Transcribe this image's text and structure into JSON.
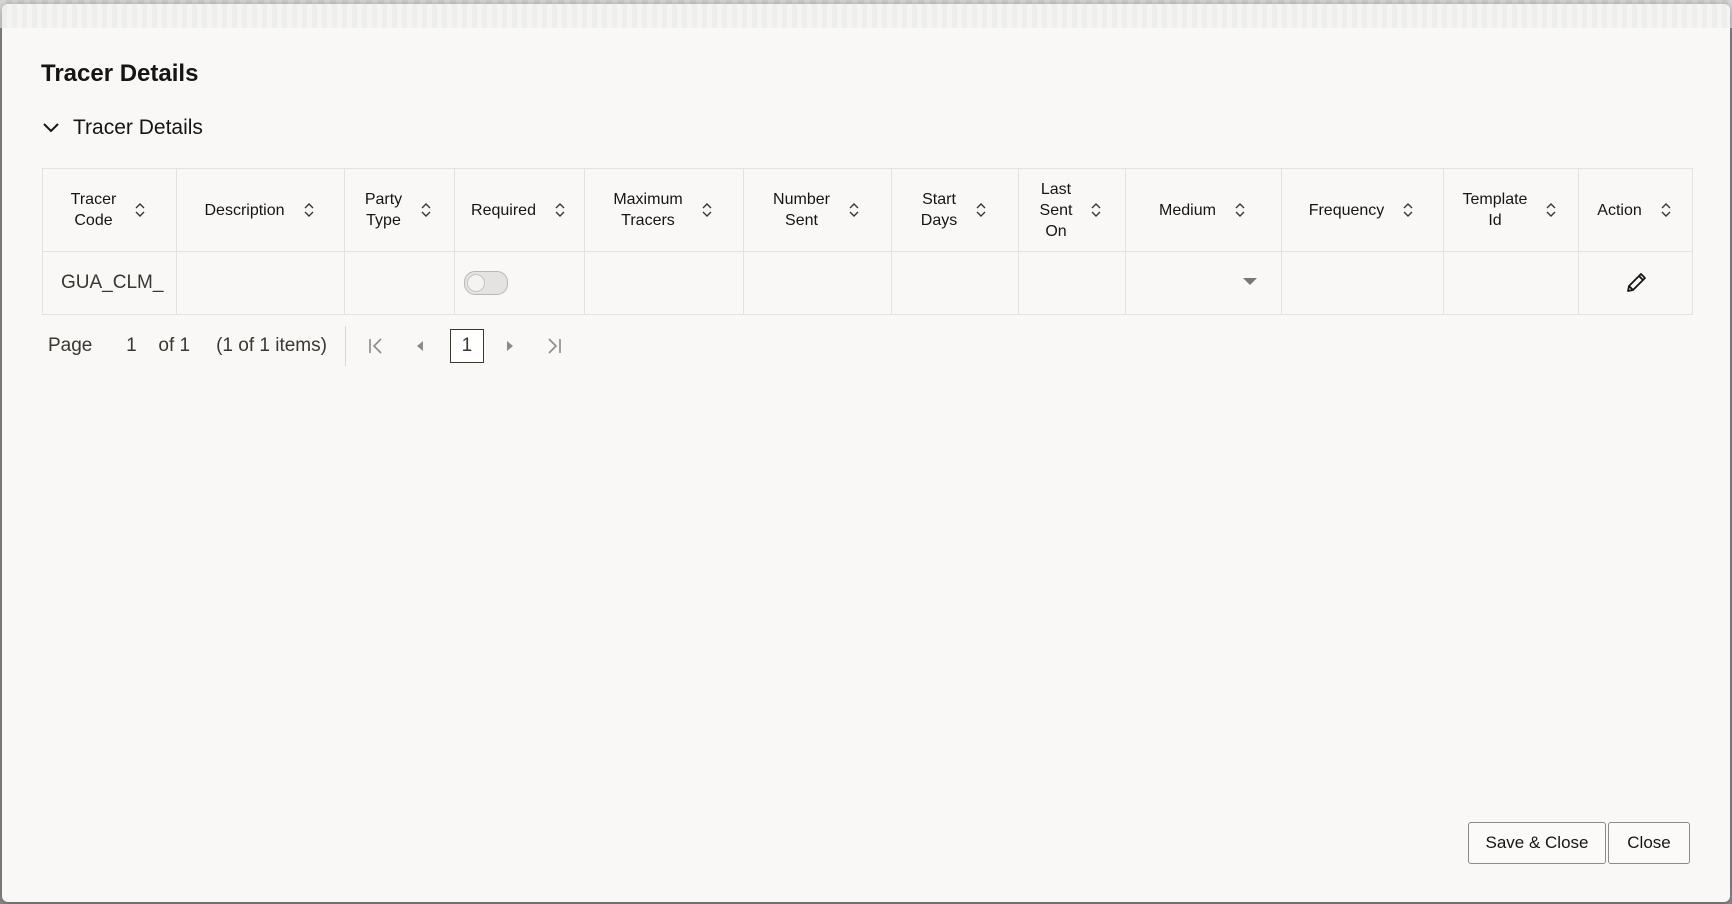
{
  "dialog": {
    "title": "Tracer Details"
  },
  "section": {
    "title": "Tracer Details",
    "expanded": true
  },
  "table": {
    "columns": [
      {
        "label": "Tracer\nCode"
      },
      {
        "label": "Description"
      },
      {
        "label": "Party\nType"
      },
      {
        "label": "Required"
      },
      {
        "label": "Maximum\nTracers"
      },
      {
        "label": "Number\nSent"
      },
      {
        "label": "Start\nDays"
      },
      {
        "label": "Last\nSent\nOn"
      },
      {
        "label": "Medium"
      },
      {
        "label": "Frequency"
      },
      {
        "label": "Template\nId"
      },
      {
        "label": "Action"
      }
    ],
    "rows": [
      {
        "tracer_code": "GUA_CLM_",
        "description": "",
        "party_type": "",
        "required": false,
        "maximum_tracers": "",
        "number_sent": "",
        "start_days": "",
        "last_sent_on": "",
        "medium": "",
        "frequency": "",
        "template_id": "",
        "action_icon": "pencil-icon"
      }
    ]
  },
  "pagination": {
    "page_label": "Page",
    "page_value": "1",
    "of_text": "of 1",
    "items_text": "(1 of 1 items)",
    "current_page": "1"
  },
  "footer": {
    "save_close_label": "Save & Close",
    "close_label": "Close"
  },
  "colors": {
    "dialog_bg": "#f9f8f6",
    "text": "#161513",
    "border": "#e3e2e0"
  }
}
